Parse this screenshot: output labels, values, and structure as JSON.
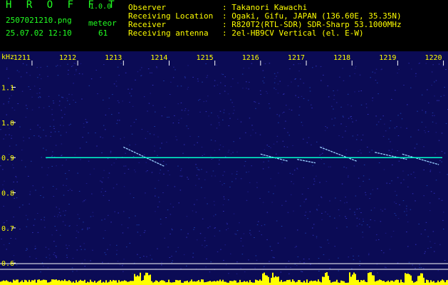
{
  "header": {
    "title": "H R O F F T",
    "version": "1.0.0",
    "filename": "2507021210.png",
    "datetime": "25.07.02 12:10",
    "meteor_label": "meteor",
    "meteor_count": "61",
    "info": [
      {
        "label": "Observer",
        "value": ": Takanori Kawachi"
      },
      {
        "label": "Receiving Location",
        "value": ": Ogaki, Gifu, JAPAN (136.60E, 35.35N)"
      },
      {
        "label": "Receiver",
        "value": ": R820T2(RTL-SDR) SDR-Sharp 53.1000MHz"
      },
      {
        "label": "Receiving antenna",
        "value": ": 2el-HB9CV Vertical (el. E-W)"
      }
    ]
  },
  "chart_data": {
    "type": "heatmap",
    "ylabel": "kHz",
    "x_ticks": [
      "1211",
      "1212",
      "1213",
      "1214",
      "1215",
      "1216",
      "1217",
      "1218",
      "1219",
      "1220"
    ],
    "x_range": [
      1210.3,
      1220.1
    ],
    "y_ticks": [
      "1.1",
      "1.0",
      "0.9",
      "0.8",
      "0.7",
      "0.6"
    ],
    "y_range": [
      0.57,
      1.17
    ],
    "carrier_khz": 0.9,
    "colors": {
      "background": "#0b0b55",
      "tick_text": "#ffff00",
      "carrier": "#00ffcc",
      "amplitude": "#ffff00",
      "axis": "#ffffff"
    }
  }
}
